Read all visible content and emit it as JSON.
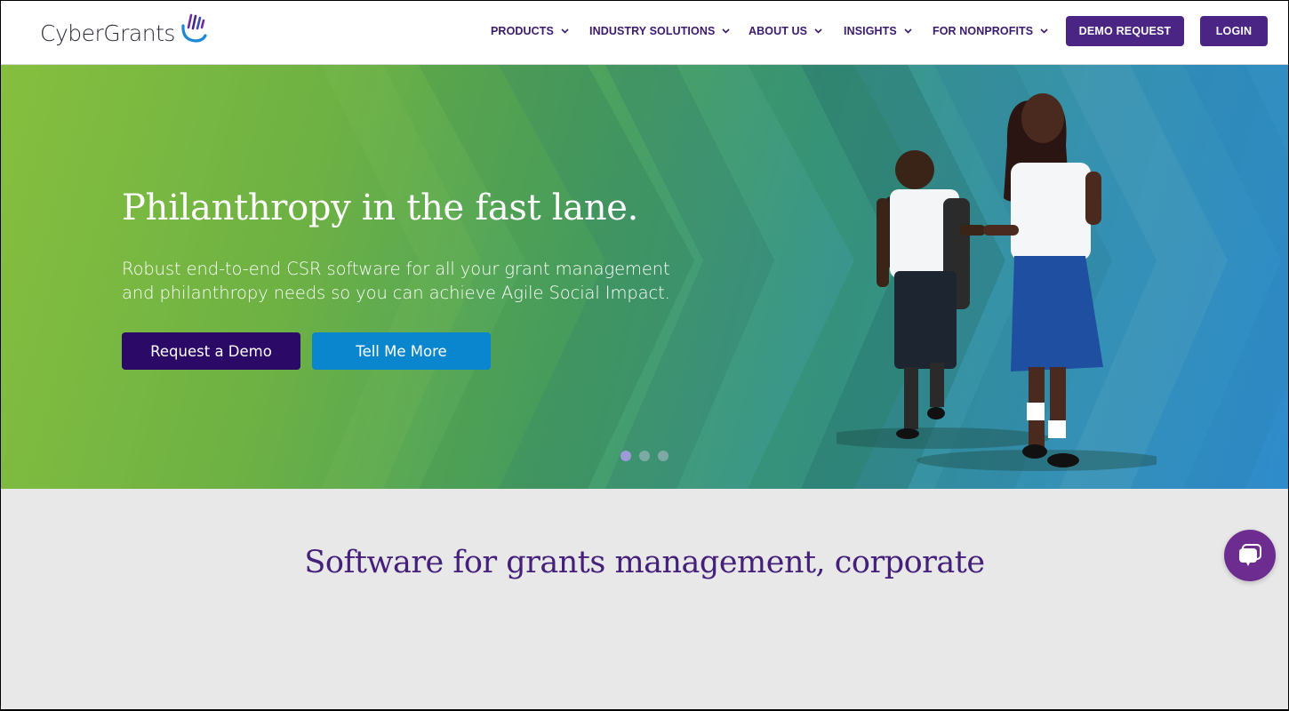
{
  "brand": {
    "name": "CyberGrants",
    "colors": {
      "primary": "#4a2583",
      "demo_button": "#2a0a66",
      "more_button": "#0a86cf",
      "heading": "#44207a",
      "chat": "#6d2c8f"
    }
  },
  "nav": {
    "items": [
      {
        "label": "PRODUCTS",
        "icon": "chevron-down-icon"
      },
      {
        "label": "INDUSTRY SOLUTIONS",
        "icon": "chevron-down-icon"
      },
      {
        "label": "ABOUT US",
        "icon": "chevron-down-icon"
      },
      {
        "label": "INSIGHTS",
        "icon": "chevron-down-icon"
      },
      {
        "label": "FOR NONPROFITS",
        "icon": "chevron-down-icon"
      }
    ],
    "demo_request": "DEMO REQUEST",
    "login": "LOGIN"
  },
  "hero": {
    "title": "Philanthropy in the fast lane.",
    "subtitle_line1": "Robust end-to-end CSR software for all your grant management",
    "subtitle_line2": "and philanthropy needs so you can achieve Agile Social Impact.",
    "primary_button": "Request a Demo",
    "secondary_button": "Tell Me More",
    "carousel": {
      "slides": 3,
      "active": 1
    }
  },
  "section": {
    "title": "Software for grants management, corporate"
  },
  "chat": {
    "icon": "chat-bubble-icon"
  }
}
